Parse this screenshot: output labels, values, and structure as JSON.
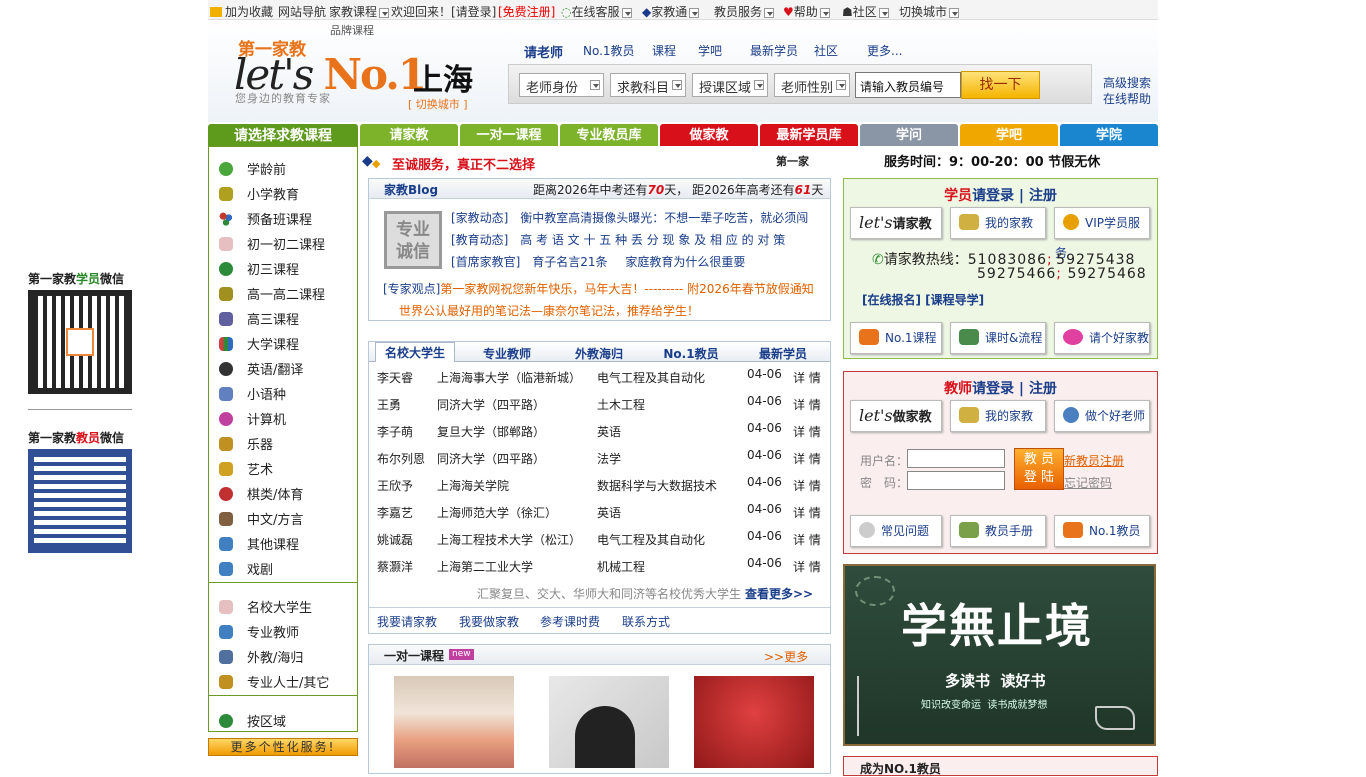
{
  "topbar": {
    "bookmark": "加为收藏",
    "site_nav": "网站导航",
    "jiajiao_course": "家教课程",
    "welcome": "欢迎回来！",
    "login": "[请登录]",
    "register": "[免费注册]",
    "online_service": "在线客服",
    "jiajiao_tong": "家教通",
    "teacher_service": "教员服务",
    "help": "帮助",
    "community": "社区",
    "switch_city": "切换城市"
  },
  "header": {
    "brand_course": "品牌课程",
    "logo_cn": "第一家教",
    "logo_lets": "let's ",
    "logo_no1": "No.1",
    "slogan": "您身边的教育专家",
    "city": "上海",
    "city_switch": "[ 切换城市 ]",
    "nav": [
      "请老师",
      "No.1教员",
      "课程",
      "学吧",
      "最新学员",
      "社区",
      "更多..."
    ],
    "selects": [
      "老师身份",
      "求教科目",
      "授课区域",
      "老师性别"
    ],
    "search_placeholder": "请输入教员编号",
    "search_button": "找一下",
    "advanced_search": "高级搜索",
    "online_help": "在线帮助"
  },
  "tabs": [
    {
      "label": "请选择求教课程",
      "color": "#5e9a1c"
    },
    {
      "label": "请家教",
      "color": "#7cb32a"
    },
    {
      "label": "一对一课程",
      "color": "#7cb32a"
    },
    {
      "label": "专业教员库",
      "color": "#7cb32a"
    },
    {
      "label": "做家教",
      "color": "#d8101a"
    },
    {
      "label": "最新学员库",
      "color": "#d8101a"
    },
    {
      "label": "学问",
      "color": "#8a96a6"
    },
    {
      "label": "学吧",
      "color": "#f0a800"
    },
    {
      "label": "学院",
      "color": "#1a86d0"
    }
  ],
  "categories": [
    {
      "label": "学龄前",
      "icon": "smile-icon",
      "color": "#4aa53a"
    },
    {
      "label": "小学教育",
      "icon": "kids-icon",
      "color": "#b0a020"
    },
    {
      "label": "预备班课程",
      "icon": "dots-icon",
      "color": "#c0392b"
    },
    {
      "label": "初一初二课程",
      "icon": "pencil-icon",
      "color": "#b05050"
    },
    {
      "label": "初三课程",
      "icon": "globe-icon",
      "color": "#2d8a3a"
    },
    {
      "label": "高一高二课程",
      "icon": "kids-icon",
      "color": "#a09020"
    },
    {
      "label": "高三课程",
      "icon": "books-icon",
      "color": "#6060a0"
    },
    {
      "label": "大学课程",
      "icon": "books-icon",
      "color": "#d04040"
    },
    {
      "label": "英语/翻译",
      "icon": "abc-icon",
      "color": "#333333"
    },
    {
      "label": "小语种",
      "icon": "language-icon",
      "color": "#6080c0"
    },
    {
      "label": "计算机",
      "icon": "heart-icon",
      "color": "#c040a0"
    },
    {
      "label": "乐器",
      "icon": "music-icon",
      "color": "#c09020"
    },
    {
      "label": "艺术",
      "icon": "art-icon",
      "color": "#d0a020"
    },
    {
      "label": "棋类/体育",
      "icon": "sport-icon",
      "color": "#c03030"
    },
    {
      "label": "中文/方言",
      "icon": "pen-icon",
      "color": "#806040"
    },
    {
      "label": "其他课程",
      "icon": "box-icon",
      "color": "#4080c0"
    },
    {
      "label": "戏剧",
      "icon": "box-icon",
      "color": "#4080c0"
    }
  ],
  "teacher_types": [
    {
      "label": "名校大学生",
      "icon": "pencil-icon",
      "color": "#b05050"
    },
    {
      "label": "专业教师",
      "icon": "book-icon",
      "color": "#4080c0"
    },
    {
      "label": "外教/海归",
      "icon": "book-icon",
      "color": "#5070a0"
    },
    {
      "label": "专业人士/其它",
      "icon": "book-icon",
      "color": "#c09020"
    }
  ],
  "by_area": "按区域",
  "more_services": "更多个性化服务!",
  "banner": {
    "slogan": "至诚服务，真正不二选择",
    "marquee": "第一家",
    "service_hours": "服务时间：9：00-20：00 节假无休"
  },
  "blog": {
    "title": "家教Blog",
    "countdown_prefix": "距离2026年中考还有",
    "zhongkao_days": "70",
    "countdown_mid": "天， 距2026年高考还有",
    "gaokao_days": "61",
    "countdown_suffix": "天",
    "badge_line1": "专业",
    "badge_line2": "诚信",
    "items": [
      {
        "tag": "[家教动态]",
        "text": "衡中教室高清摄像头曝光：不想一辈子吃苦，就必须闯"
      },
      {
        "tag": "[教育动态]",
        "text": "高 考 语 文 十 五 种 丢 分 现 象 及 相 应 的 对 策"
      },
      {
        "tag": "[首席家教官]",
        "text": "育子名言21条",
        "text2": "家庭教育为什么很重要"
      }
    ],
    "view_tag": "[专家观点]",
    "view_text": "第一家教网祝您新年快乐，马年大吉！--------- 附2026年春节放假通知",
    "view_text2": "世界公认最好用的笔记法—康奈尔笔记法，推荐给学生！"
  },
  "teacher_list": {
    "tabs": [
      "名校大学生",
      "专业教师",
      "外教海归",
      "No.1教员",
      "最新学员"
    ],
    "rows": [
      {
        "name": "李天睿",
        "school": "上海海事大学（临港新城）",
        "major": "电气工程及其自动化",
        "date": "04-06",
        "detail": "详 情"
      },
      {
        "name": "王勇",
        "school": "同济大学（四平路）",
        "major": "土木工程",
        "date": "04-06",
        "detail": "详 情"
      },
      {
        "name": "李子萌",
        "school": "复旦大学（邯郸路）",
        "major": "英语",
        "date": "04-06",
        "detail": "详 情"
      },
      {
        "name": "布尔列恩",
        "school": "同济大学（四平路）",
        "major": "法学",
        "date": "04-06",
        "detail": "详 情"
      },
      {
        "name": "王欣予",
        "school": "上海海关学院",
        "major": "数据科学与大数据技术",
        "date": "04-06",
        "detail": "详 情"
      },
      {
        "name": "李嘉艺",
        "school": "上海师范大学（徐汇）",
        "major": "英语",
        "date": "04-06",
        "detail": "详 情"
      },
      {
        "name": "姚诚磊",
        "school": "上海工程技术大学（松江）",
        "major": "电气工程及其自动化",
        "date": "04-06",
        "detail": "详 情"
      },
      {
        "name": "蔡灏洋",
        "school": "上海第二工业大学",
        "major": "机械工程",
        "date": "04-06",
        "detail": "详 情"
      }
    ],
    "footer_text": "汇聚复旦、交大、华师大和同济等名校优秀大学生",
    "more": "查看更多>>",
    "links": [
      "我要请家教",
      "我要做家教",
      "参考课时费",
      "联系方式"
    ]
  },
  "one_on_one": {
    "title": "一对一课程",
    "new_badge": "new",
    "more": ">>更多"
  },
  "student_panel": {
    "title_a": "学员",
    "title_b": "请登录",
    "title_c": "注册",
    "btn1": "请家教",
    "btn1_prefix": "let's",
    "btn2": "我的家教",
    "btn3": "VIP学员服务",
    "hotline_label": "请家教热线：",
    "hotline1": "51083086",
    "hotline2": "59275438",
    "hotline3": "59275466",
    "hotline4": "59275468",
    "links": "[在线报名] [课程导学]",
    "btn4": "No.1课程",
    "btn5": "课时&流程",
    "btn6": "请个好家教"
  },
  "teacher_panel": {
    "title_a": "教师",
    "title_b": "请登录",
    "title_c": "注册",
    "btn1": "做家教",
    "btn1_prefix": "let's",
    "btn2": "我的家教",
    "btn3": "做个好老师",
    "username_label": "用户名：",
    "password_label": "密　码：",
    "login_btn_line1": "教 员",
    "login_btn_line2": "登 陆",
    "register_link": "新教员注册",
    "forgot_link": "忘记密码",
    "btn4": "常见问题",
    "btn5": "教员手册",
    "btn6": "No.1教员"
  },
  "ad_banner": {
    "text1": "学無止境",
    "text2": "多读书  读好书",
    "text3": "知识改变命运  读书成就梦想"
  },
  "become_no1": "成为NO.1教员",
  "qr": {
    "student_a": "第一家教",
    "student_b": "学员",
    "student_c": "微信",
    "teacher_a": "第一家教",
    "teacher_b": "教员",
    "teacher_c": "微信"
  }
}
